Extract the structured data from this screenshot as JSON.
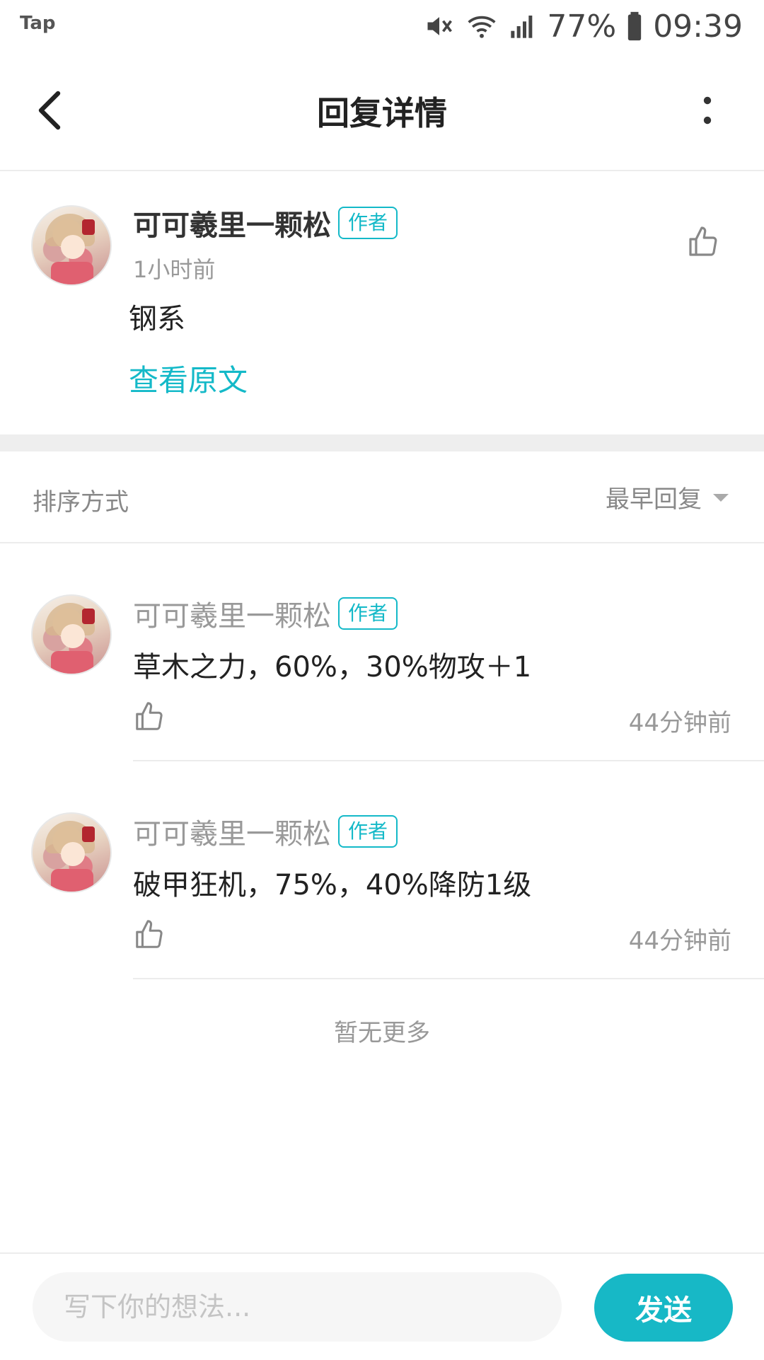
{
  "status_bar": {
    "app_label": "Tap",
    "battery": "77%",
    "time": "09:39",
    "icons": [
      "mute-icon",
      "wifi-icon",
      "signal-icon",
      "battery-icon"
    ]
  },
  "header": {
    "title": "回复详情",
    "icons": [
      "back-arrow-icon",
      "more-vertical-icon"
    ]
  },
  "post": {
    "author": "可可羲里一颗松",
    "tag": "作者",
    "time": "1小时前",
    "content": "钢系",
    "view_original": "查看原文",
    "like_icon": "thumbs-up-icon"
  },
  "sort": {
    "label": "排序方式",
    "value": "最早回复",
    "icon": "caret-down-icon"
  },
  "replies": [
    {
      "author": "可可羲里一颗松",
      "tag": "作者",
      "content": "草木之力，60%，30%物攻＋1",
      "time": "44分钟前"
    },
    {
      "author": "可可羲里一颗松",
      "tag": "作者",
      "content": "破甲狂机，75%，40%降防1级",
      "time": "44分钟前"
    }
  ],
  "footer_note": "暂无更多",
  "composer": {
    "placeholder": "写下你的想法...",
    "send_label": "发送"
  },
  "colors": {
    "accent": "#17b8c6",
    "muted_text": "#999999",
    "divider": "#eeeeee"
  }
}
